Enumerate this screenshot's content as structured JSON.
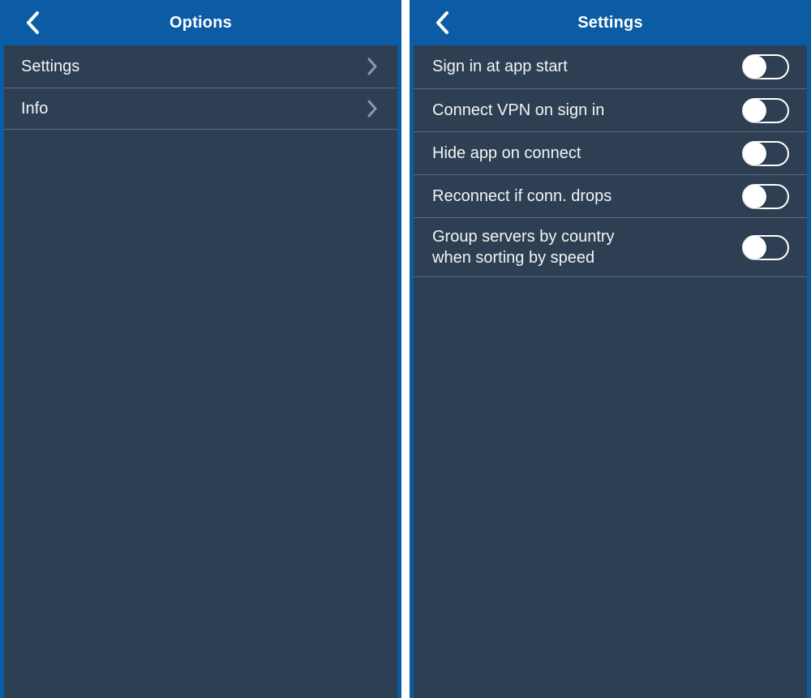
{
  "colors": {
    "nav_blue": "#0b5ca5",
    "panel_bg": "#2c3e53",
    "row_bg": "#2e3f53",
    "divider": "#5f6b79",
    "text": "#f2f4f6",
    "chevron": "#8d99a7",
    "toggle_track": "#ffffff",
    "toggle_knob": "#ffffff"
  },
  "left_screen": {
    "name": "options-screen",
    "navbar": {
      "back_icon": "chevron-left-icon",
      "title": "Options"
    },
    "items": [
      {
        "label": "Settings",
        "accessory_icon": "chevron-right-icon"
      },
      {
        "label": "Info",
        "accessory_icon": "chevron-right-icon"
      }
    ]
  },
  "right_screen": {
    "name": "settings-screen",
    "navbar": {
      "back_icon": "chevron-left-icon",
      "title": "Settings"
    },
    "settings": [
      {
        "label_lines": [
          "Sign in at app start"
        ],
        "label": "Sign in at app start",
        "toggle": {
          "state": "off",
          "state_label": "Off"
        }
      },
      {
        "label_lines": [
          "Connect VPN on sign in"
        ],
        "label": "Connect VPN on sign in",
        "toggle": {
          "state": "off",
          "state_label": "Off"
        }
      },
      {
        "label_lines": [
          "Hide app on connect"
        ],
        "label": "Hide app on connect",
        "toggle": {
          "state": "off",
          "state_label": "Off"
        }
      },
      {
        "label_lines": [
          "Reconnect if conn. drops"
        ],
        "label": "Reconnect if conn. drops",
        "toggle": {
          "state": "off",
          "state_label": "Off"
        }
      },
      {
        "label_lines": [
          "Group servers by country",
          "when sorting by speed"
        ],
        "label": "Group servers by country when sorting by speed",
        "toggle": {
          "state": "off",
          "state_label": "Off"
        }
      }
    ]
  }
}
